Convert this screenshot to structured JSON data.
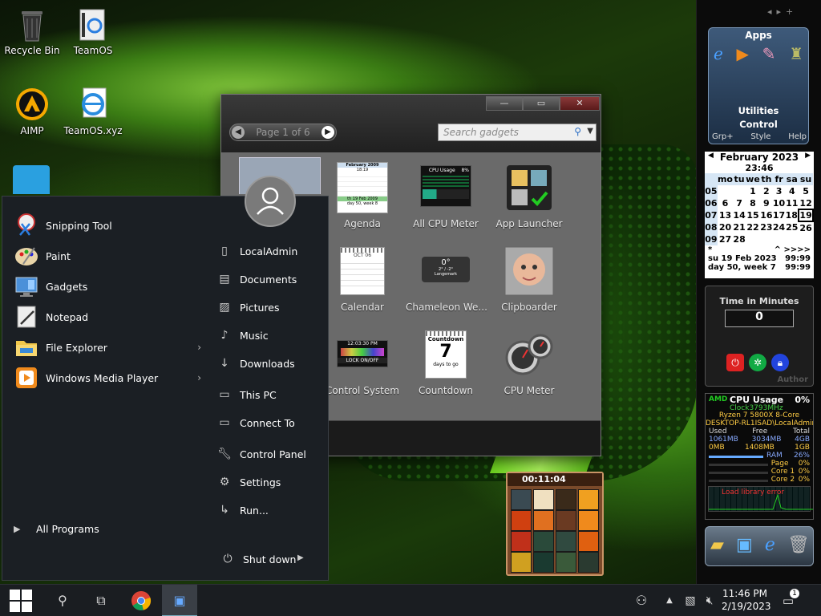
{
  "desktop": {
    "icons": [
      {
        "label": "Recycle Bin"
      },
      {
        "label": "TeamOS"
      },
      {
        "label": "AIMP"
      },
      {
        "label": "TeamOS.xyz"
      }
    ]
  },
  "gadget_window": {
    "pager_text": "Page 1 of 6",
    "search_placeholder": "Search gadgets",
    "gadgets": [
      {
        "label": "Agenda"
      },
      {
        "label": "All CPU Meter"
      },
      {
        "label": "App Launcher"
      },
      {
        "label": "Calendar"
      },
      {
        "label": "Chameleon We..."
      },
      {
        "label": "Clipboarder"
      },
      {
        "label": "Control System"
      },
      {
        "label": "Countdown"
      },
      {
        "label": "CPU Meter"
      }
    ],
    "agenda_thumb": {
      "month": "February 2009",
      "time": "18:19",
      "foot1": "th 19 Feb 2009",
      "foot2": "day 50, week 8"
    },
    "cpu_thumb": {
      "title": "CPU Usage",
      "pct": "8%"
    },
    "calendar_thumb": {
      "month": "OCT 06"
    },
    "weather_thumb": {
      "temp": "0°",
      "range": "2° / -2°",
      "place": "Langemark"
    },
    "control_thumb": {
      "time": "12:03:30 PM",
      "lock": "LOCK ON/OFF"
    },
    "countdown_thumb": {
      "title": "Countdown",
      "num": "7",
      "sub": "days to go"
    }
  },
  "start_menu": {
    "programs": [
      {
        "label": "Snipping Tool"
      },
      {
        "label": "Paint"
      },
      {
        "label": "Gadgets"
      },
      {
        "label": "Notepad"
      },
      {
        "label": "File Explorer",
        "chevron": "›"
      },
      {
        "label": "Windows Media Player",
        "chevron": "›"
      }
    ],
    "all_programs": "All Programs",
    "links": [
      {
        "label": "LocalAdmin"
      },
      {
        "label": "Documents"
      },
      {
        "label": "Pictures"
      },
      {
        "label": "Music"
      },
      {
        "label": "Downloads"
      },
      {
        "label": "This PC"
      },
      {
        "label": "Connect To"
      },
      {
        "label": "Control Panel"
      },
      {
        "label": "Settings"
      },
      {
        "label": "Run..."
      }
    ],
    "shutdown": "Shut down"
  },
  "sidebar": {
    "apps_panel": {
      "title": "Apps",
      "utilities": "Utilities",
      "control": "Control",
      "grp": "Grp+",
      "style": "Style",
      "help": "Help"
    },
    "calendar": {
      "month": "February 2023",
      "time": "23:46",
      "days": [
        "mo",
        "tu",
        "we",
        "th",
        "fr",
        "sa",
        "su"
      ],
      "weeks": [
        {
          "w": "05",
          "d": [
            "",
            "",
            "1",
            "2",
            "3",
            "4",
            "5"
          ]
        },
        {
          "w": "06",
          "d": [
            "6",
            "7",
            "8",
            "9",
            "10",
            "11",
            "12"
          ]
        },
        {
          "w": "07",
          "d": [
            "13",
            "14",
            "15",
            "16",
            "17",
            "18",
            "19"
          ]
        },
        {
          "w": "08",
          "d": [
            "20",
            "21",
            "22",
            "23",
            "24",
            "25",
            "26"
          ]
        },
        {
          "w": "09",
          "d": [
            "27",
            "28",
            "",
            "",
            "",
            "",
            ""
          ]
        }
      ],
      "nav": "^ >>>>",
      "nav_left": "*",
      "foot1": "su 19 Feb 2023",
      "foot1r": "99:99",
      "foot2": "day 50, week 7",
      "foot2r": "99:99"
    },
    "timer": {
      "title": "Time in Minutes",
      "value": "0",
      "author": "Author"
    },
    "cpu": {
      "title": "CPU Usage",
      "pct": "0%",
      "brand": "AMD",
      "clock": "Clock3793MHz",
      "model": "Ryzen 7 5800X 8-Core",
      "host": "DESKTOP-RL1ISAD\\LocalAdmin",
      "hdr": [
        "Used",
        "Free",
        "Total"
      ],
      "row1": [
        "1061MB",
        "3034MB",
        "4GB"
      ],
      "row2": [
        "0MB",
        "1408MB",
        "1GB"
      ],
      "ram": "RAM",
      "ram_pct": "26%",
      "page": "Page",
      "page_pct": "0%",
      "core1": "Core 1",
      "core1_pct": "0%",
      "core2": "Core 2",
      "core2_pct": "0%",
      "err": "Load library error"
    }
  },
  "puzzle": {
    "time": "00:11:04"
  },
  "taskbar": {
    "time": "11:46 PM",
    "date": "2/19/2023",
    "notif_count": "1"
  }
}
